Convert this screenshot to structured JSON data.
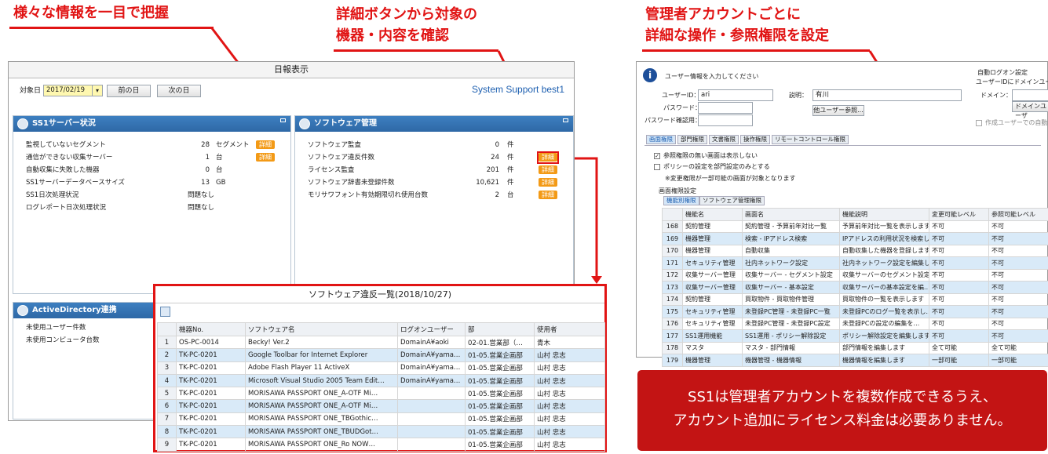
{
  "headings": {
    "left": "様々な情報を一目で把握",
    "middle_1": "詳細ボタンから対象の",
    "middle_2": "機器・内容を確認",
    "right_1": "管理者アカウントごとに",
    "right_2": "詳細な操作・参照権限を設定"
  },
  "daily_report": {
    "title": "日報表示",
    "date_label": "対象日",
    "date_value": "2017/02/19",
    "prev_button": "前の日",
    "next_button": "次の日",
    "logo": "System Support best1",
    "server_panel": {
      "title": "SS1サーバー状況",
      "rows": [
        {
          "label": "監視していないセグメント",
          "value": "28",
          "unit": "セグメント",
          "detail": "詳細"
        },
        {
          "label": "通信ができない収集サーバー",
          "value": "1",
          "unit": "台",
          "detail": "詳細"
        },
        {
          "label": "自動収集に失敗した機器",
          "value": "0",
          "unit": "台",
          "detail": ""
        },
        {
          "label": "SS1サーバーデータベースサイズ",
          "value": "13",
          "unit": "GB",
          "detail": ""
        },
        {
          "label": "SS1日次処理状況",
          "value": "問題なし",
          "unit": "",
          "detail": ""
        },
        {
          "label": "ログレポート日次処理状況",
          "value": "問題なし",
          "unit": "",
          "detail": ""
        }
      ]
    },
    "software_panel": {
      "title": "ソフトウェア管理",
      "rows": [
        {
          "label": "ソフトウェア監査",
          "value": "0",
          "unit": "件",
          "detail": ""
        },
        {
          "label": "ソフトウェア違反件数",
          "value": "24",
          "unit": "件",
          "detail": "詳細"
        },
        {
          "label": "ライセンス監査",
          "value": "201",
          "unit": "件",
          "detail": "詳細"
        },
        {
          "label": "ソフトウェア辞書未登録件数",
          "value": "10,621",
          "unit": "件",
          "detail": "詳細"
        },
        {
          "label": "モリサワフォント有効期限切れ使用台数",
          "value": "2",
          "unit": "台",
          "detail": "詳細"
        }
      ]
    },
    "ad_panel": {
      "title": "ActiveDirectory連携",
      "rows": [
        "未使用ユーザー件数",
        "未使用コンピュータ台数"
      ]
    }
  },
  "violation_list": {
    "title": "ソフトウェア違反一覧(2018/10/27)",
    "columns": [
      "",
      "機器No.",
      "ソフトウェア名",
      "ログオンユーザー",
      "部",
      "使用者"
    ],
    "rows": [
      [
        "1",
        "OS-PC-0014",
        "Becky! Ver.2",
        "DomainA¥aoki",
        "02-01.営業部（…",
        "青木"
      ],
      [
        "2",
        "TK-PC-0201",
        "Google Toolbar for Internet Explorer",
        "DomainA¥yama…",
        "01-05.営業企画部",
        "山村 忠志"
      ],
      [
        "3",
        "TK-PC-0201",
        "Adobe Flash Player 11 ActiveX",
        "DomainA¥yama…",
        "01-05.営業企画部",
        "山村 忠志"
      ],
      [
        "4",
        "TK-PC-0201",
        "Microsoft Visual Studio 2005 Team Edit…",
        "DomainA¥yama…",
        "01-05.営業企画部",
        "山村 忠志"
      ],
      [
        "5",
        "TK-PC-0201",
        "MORISAWA PASSPORT ONE_A-OTF Mi…",
        "",
        "01-05.営業企画部",
        "山村 忠志"
      ],
      [
        "6",
        "TK-PC-0201",
        "MORISAWA PASSPORT ONE_A-OTF Mi…",
        "",
        "01-05.営業企画部",
        "山村 忠志"
      ],
      [
        "7",
        "TK-PC-0201",
        "MORISAWA PASSPORT ONE_TBGothic…",
        "",
        "01-05.営業企画部",
        "山村 忠志"
      ],
      [
        "8",
        "TK-PC-0201",
        "MORISAWA PASSPORT ONE_TBUDGot…",
        "",
        "01-05.営業企画部",
        "山村 忠志"
      ],
      [
        "9",
        "TK-PC-0201",
        "MORISAWA PASSPORT ONE_Ro NOW…",
        "",
        "01-05.営業企画部",
        "山村 忠志"
      ]
    ]
  },
  "user_settings": {
    "prompt": "ユーザー情報を入力してください",
    "user_id_label": "ユーザーID：",
    "user_id_value": "ari",
    "description_label": "説明：",
    "description_value": "有川",
    "password_label": "パスワード：",
    "password_confirm_label": "パスワード確認用：",
    "other_user_button": "他ユーザー参照...",
    "auto_logon_group": "自動ログオン設定",
    "domain_note": "ユーザーIDにドメインユーザ",
    "domain_label": "ドメイン：",
    "domain_user_button": "ドメインユーザ",
    "creator_auto_check": "作成ユーザーでの自動ロ",
    "tabs": [
      "画面権限",
      "部門権限",
      "文書権限",
      "操作権限",
      "リモートコントロール権限"
    ],
    "check_hide": "参照権限の無い画面は表示しない",
    "check_policy": "ポリシーの設定を部門設定のみとする",
    "policy_note": "※変更権限が一部可能の画面が対象となります",
    "screen_perm_group": "画面権限設定",
    "sub_tabs": [
      "機能別権限",
      "ソフトウェア管理権限"
    ],
    "columns": [
      "",
      "機能名",
      "画面名",
      "機能説明",
      "変更可能レベル",
      "参照可能レベル"
    ],
    "rows": [
      [
        "168",
        "契約管理",
        "契約管理 - 予算前年対比一覧",
        "予算前年対比一覧を表示します",
        "不可",
        "不可"
      ],
      [
        "169",
        "機器管理",
        "検索 - IPアドレス検索",
        "IPアドレスの利用状況を検索し…",
        "不可",
        "不可"
      ],
      [
        "170",
        "機器管理",
        "自動収集",
        "自動収集した機器を登録します",
        "不可",
        "不可"
      ],
      [
        "171",
        "セキュリティ管理",
        "社内ネットワーク設定",
        "社内ネットワーク設定を編集し…",
        "不可",
        "不可"
      ],
      [
        "172",
        "収集サーバー管理",
        "収集サーバー - セグメント設定",
        "収集サーバーのセグメント設定…",
        "不可",
        "不可"
      ],
      [
        "173",
        "収集サーバー管理",
        "収集サーバー - 基本設定",
        "収集サーバーの基本設定を編…",
        "不可",
        "不可"
      ],
      [
        "174",
        "契約管理",
        "買取物件 - 買取物件管理",
        "買取物件の一覧を表示します",
        "不可",
        "不可"
      ],
      [
        "175",
        "セキュリティ管理",
        "未登録PC管理 - 未登録PC一覧",
        "未登録PCのログ一覧を表示し…",
        "不可",
        "不可"
      ],
      [
        "176",
        "セキュリティ管理",
        "未登録PC管理 - 未登録PC設定",
        "未登録PCの設定の編集を…",
        "不可",
        "不可"
      ],
      [
        "177",
        "SS1運用機能",
        "SS1運用 - ポリシー解除設定",
        "ポリシー解除設定を編集します",
        "不可",
        "不可"
      ],
      [
        "178",
        "マスタ",
        "マスタ - 部門情報",
        "部門情報を編集します",
        "全て可能",
        "全て可能"
      ],
      [
        "179",
        "機器管理",
        "機器管理 - 機器情報",
        "機器情報を編集します",
        "一部可能",
        "一部可能"
      ]
    ]
  },
  "note": {
    "line1": "SS1は管理者アカウントを複数作成できるうえ、",
    "line2": "アカウント追加にライセンス料金は必要ありません。"
  },
  "colors": {
    "accent_red": "#e11414",
    "panel_blue": "#2e68a6",
    "badge_orange": "#f39a16",
    "note_bg": "#c31414"
  }
}
